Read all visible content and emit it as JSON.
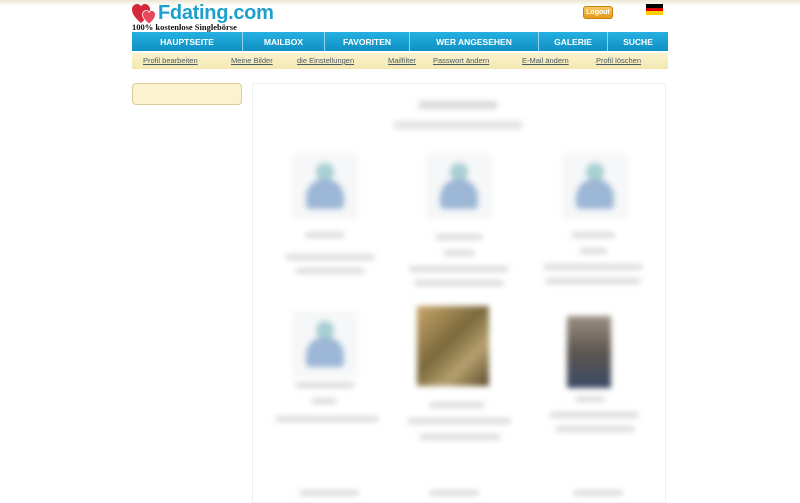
{
  "header": {
    "logo_text": "Fdating.com",
    "tagline": "100% kostenlose Singlebörse",
    "logout_label": "Logout",
    "flag_colors": [
      "#000000",
      "#dd0000",
      "#ffce00"
    ],
    "icons": [
      "hearts-logo-icon",
      "german-flag-icon"
    ]
  },
  "nav": {
    "items": [
      {
        "label": "HAUPTSEITE"
      },
      {
        "label": "MAILBOX"
      },
      {
        "label": "FAVORITEN"
      },
      {
        "label": "WER ANGESEHEN"
      },
      {
        "label": "GALERIE"
      },
      {
        "label": "SUCHE"
      }
    ]
  },
  "subnav": {
    "items": [
      {
        "label": "Profil bearbeiten"
      },
      {
        "label": "Meine Bilder"
      },
      {
        "label": "die Einstellungen"
      },
      {
        "label": "Mailfilter"
      },
      {
        "label": "Passwort ändern"
      },
      {
        "label": "E-Mail ändern"
      },
      {
        "label": "Profil löschen"
      }
    ]
  },
  "colors": {
    "brand_blue": "#1ea0cf",
    "nav_blue": "#1aa2d6",
    "subnav_bg": "#f6ecbf",
    "logout_orange": "#e9a526",
    "heart_red": "#d6283a"
  }
}
